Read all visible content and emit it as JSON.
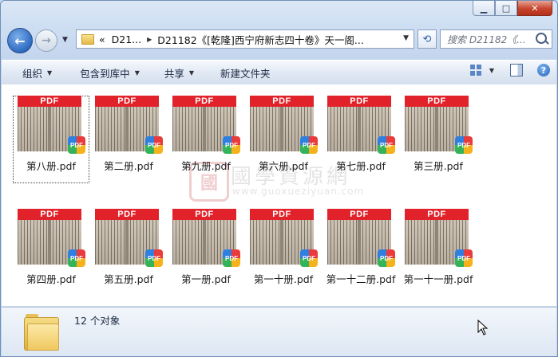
{
  "window": {
    "buttons": {
      "minimize": "▁",
      "maximize": "□",
      "close": "✕"
    }
  },
  "nav": {
    "address": {
      "overflow": "«",
      "crumbs": [
        "D21...",
        "D21182《[乾隆]西宁府新志四十卷》天一阁..."
      ]
    },
    "search_placeholder": "搜索 D21182《..."
  },
  "toolbar": {
    "items": [
      "组织",
      "包含到库中",
      "共享",
      "新建文件夹"
    ]
  },
  "files": [
    {
      "name": "第八册.pdf",
      "selected": true
    },
    {
      "name": "第二册.pdf",
      "selected": false
    },
    {
      "name": "第九册.pdf",
      "selected": false
    },
    {
      "name": "第六册.pdf",
      "selected": false
    },
    {
      "name": "第七册.pdf",
      "selected": false
    },
    {
      "name": "第三册.pdf",
      "selected": false
    },
    {
      "name": "第四册.pdf",
      "selected": false
    },
    {
      "name": "第五册.pdf",
      "selected": false
    },
    {
      "name": "第一册.pdf",
      "selected": false
    },
    {
      "name": "第一十册.pdf",
      "selected": false
    },
    {
      "name": "第一十二册.pdf",
      "selected": false
    },
    {
      "name": "第一十一册.pdf",
      "selected": false
    }
  ],
  "thumb_banner": "PDF",
  "thumb_badge": "PDF",
  "watermark": {
    "seal": "國",
    "title": "國學資源網",
    "url": "www.guoxueziyuan.com"
  },
  "status": {
    "count_text": "12 个对象"
  },
  "colors": {
    "pdf_banner": "#e2222a",
    "accent": "#2d6ac2"
  }
}
